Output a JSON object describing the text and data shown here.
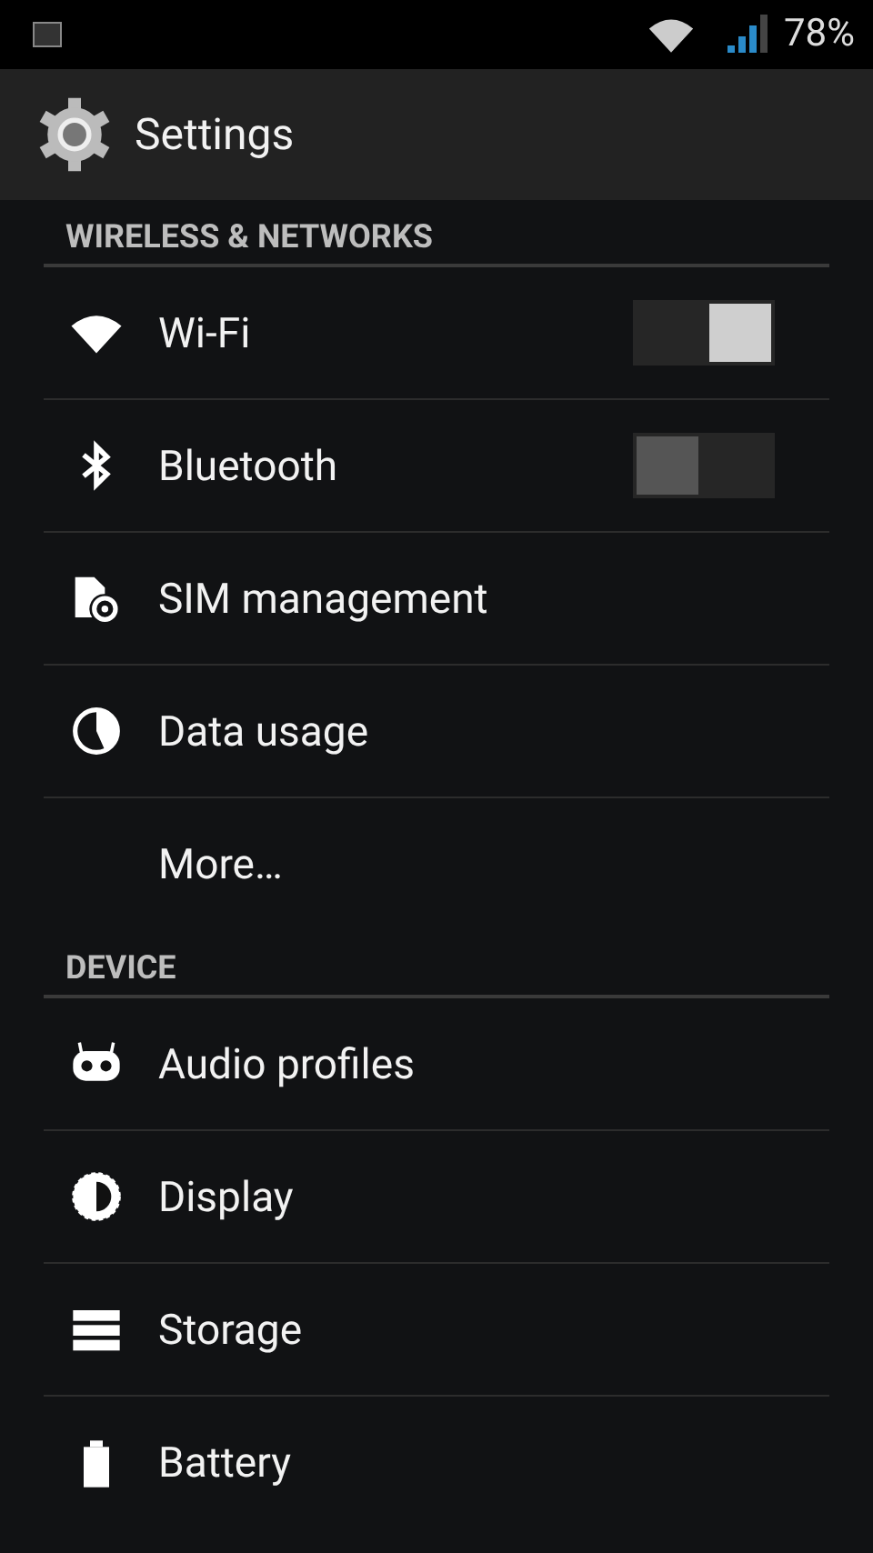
{
  "status_bar": {
    "battery": "78%"
  },
  "action_bar": {
    "title": "Settings"
  },
  "sections": [
    {
      "header": "WIRELESS & NETWORKS",
      "items": [
        {
          "label": "Wi-Fi",
          "kind": "switch",
          "on": true
        },
        {
          "label": "Bluetooth",
          "kind": "switch",
          "on": false
        },
        {
          "label": "SIM management",
          "kind": "plain"
        },
        {
          "label": "Data usage",
          "kind": "plain"
        },
        {
          "label": "More…",
          "kind": "plain"
        }
      ]
    },
    {
      "header": "DEVICE",
      "items": [
        {
          "label": "Audio profiles",
          "kind": "plain"
        },
        {
          "label": "Display",
          "kind": "plain"
        },
        {
          "label": "Storage",
          "kind": "plain"
        },
        {
          "label": "Battery",
          "kind": "plain"
        }
      ]
    }
  ]
}
